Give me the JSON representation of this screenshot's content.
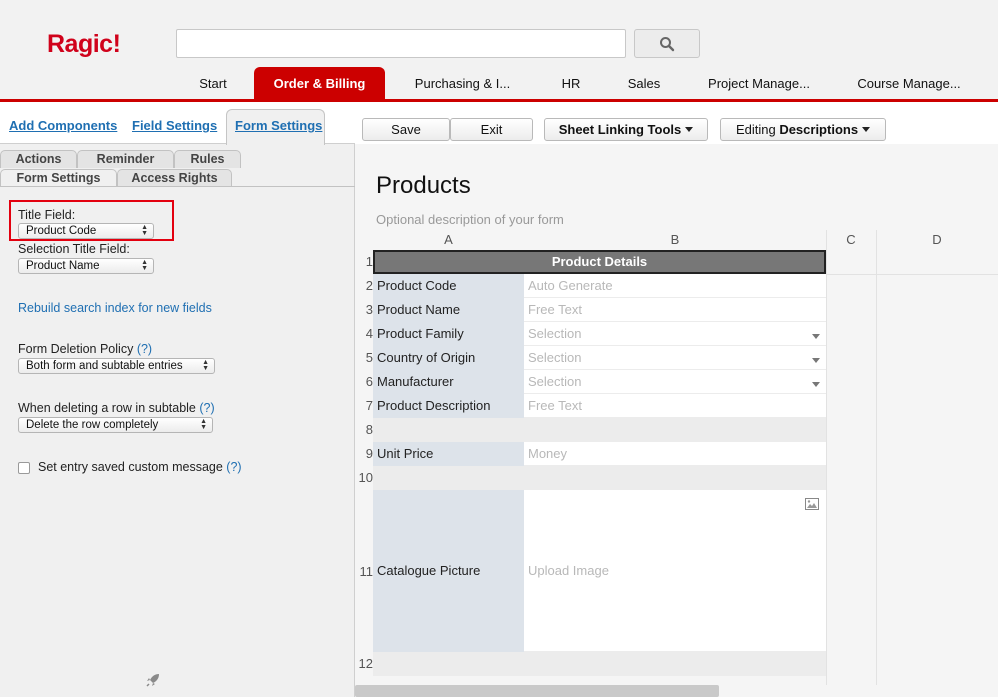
{
  "header": {
    "logo": "Ragic!",
    "search_placeholder": "",
    "tabs": [
      {
        "label": "Start"
      },
      {
        "label": "Order & Billing"
      },
      {
        "label": "Purchasing & I..."
      },
      {
        "label": "HR"
      },
      {
        "label": "Sales"
      },
      {
        "label": "Project Manage..."
      },
      {
        "label": "Course Manage..."
      }
    ],
    "active_tab": "Order & Billing",
    "accent_color": "#cc0000"
  },
  "left_panel": {
    "tabs": [
      "Add Components",
      "Field Settings",
      "Form Settings"
    ],
    "active_tab": "Form Settings",
    "subtabs": [
      "Actions",
      "Reminder",
      "Rules",
      "Form Settings",
      "Access Rights"
    ],
    "active_subtab": "Form Settings",
    "title_field": {
      "label": "Title Field:",
      "value": "Product Code"
    },
    "selection_title_field": {
      "label": "Selection Title Field:",
      "value": "Product Name"
    },
    "rebuild_link": "Rebuild search index for new fields",
    "deletion_policy": {
      "label": "Form Deletion Policy",
      "help": "(?)",
      "value": "Both form and subtable entries"
    },
    "subtable_delete": {
      "label": "When deleting a row in subtable",
      "help": "(?)",
      "value": "Delete the row completely"
    },
    "custom_message": {
      "label": "Set entry saved custom message",
      "help": "(?)",
      "checked": false
    }
  },
  "toolbar": {
    "save": "Save",
    "exit": "Exit",
    "sheet_linking": "Sheet Linking Tools",
    "editing_prefix": "Editing ",
    "editing_mode": "Descriptions"
  },
  "form": {
    "title": "Products",
    "description_placeholder": "Optional description of your form",
    "columns": [
      "A",
      "B",
      "C",
      "D"
    ],
    "section_header": "Product Details",
    "rows": [
      {
        "num": "1"
      },
      {
        "num": "2",
        "label": "Product Code",
        "value": "Auto Generate",
        "dropdown": false
      },
      {
        "num": "3",
        "label": "Product Name",
        "value": "Free Text",
        "dropdown": false
      },
      {
        "num": "4",
        "label": "Product Family",
        "value": "Selection",
        "dropdown": true
      },
      {
        "num": "5",
        "label": "Country of Origin",
        "value": "Selection",
        "dropdown": true
      },
      {
        "num": "6",
        "label": "Manufacturer",
        "value": "Selection",
        "dropdown": true
      },
      {
        "num": "7",
        "label": "Product Description",
        "value": "Free Text",
        "dropdown": false
      },
      {
        "num": "8"
      },
      {
        "num": "9",
        "label": "Unit Price",
        "value": "Money",
        "dropdown": false
      },
      {
        "num": "10"
      },
      {
        "num": "11",
        "label": "Catalogue Picture",
        "value": "Upload Image",
        "dropdown": false
      },
      {
        "num": "12"
      }
    ]
  }
}
